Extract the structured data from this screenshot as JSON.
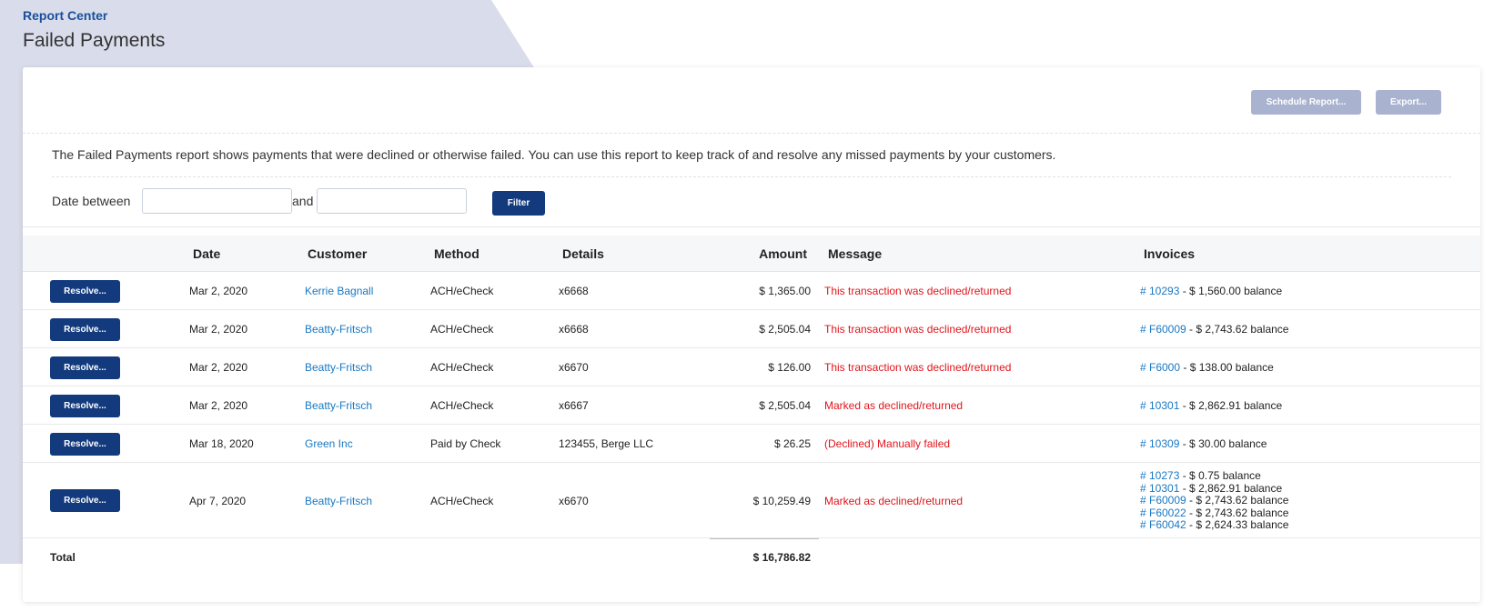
{
  "header": {
    "breadcrumb": "Report Center",
    "title": "Failed Payments"
  },
  "toolbar": {
    "schedule_label": "Schedule Report...",
    "export_label": "Export..."
  },
  "description": "The Failed Payments report shows payments that were declined or otherwise failed. You can use this report to keep track of and resolve any missed payments by your customers.",
  "filter": {
    "label": "Date between",
    "and": "and",
    "from_value": "",
    "to_value": "",
    "button": "Filter"
  },
  "columns": {
    "date": "Date",
    "customer": "Customer",
    "method": "Method",
    "details": "Details",
    "amount": "Amount",
    "message": "Message",
    "invoices": "Invoices"
  },
  "resolve_label": "Resolve...",
  "rows": [
    {
      "date": "Mar 2, 2020",
      "customer": "Kerrie Bagnall",
      "method": "ACH/eCheck",
      "details": "x6668",
      "amount": "$ 1,365.00",
      "message": "This transaction was declined/returned",
      "invoices": [
        {
          "num": "# 10293",
          "bal": " - $ 1,560.00 balance"
        }
      ]
    },
    {
      "date": "Mar 2, 2020",
      "customer": "Beatty-Fritsch",
      "method": "ACH/eCheck",
      "details": "x6668",
      "amount": "$ 2,505.04",
      "message": "This transaction was declined/returned",
      "invoices": [
        {
          "num": "# F60009",
          "bal": " - $ 2,743.62 balance"
        }
      ]
    },
    {
      "date": "Mar 2, 2020",
      "customer": "Beatty-Fritsch",
      "method": "ACH/eCheck",
      "details": "x6670",
      "amount": "$ 126.00",
      "message": "This transaction was declined/returned",
      "invoices": [
        {
          "num": "# F6000",
          "bal": " - $ 138.00 balance"
        }
      ]
    },
    {
      "date": "Mar 2, 2020",
      "customer": "Beatty-Fritsch",
      "method": "ACH/eCheck",
      "details": "x6667",
      "amount": "$ 2,505.04",
      "message": "Marked as declined/returned",
      "invoices": [
        {
          "num": "# 10301",
          "bal": " - $ 2,862.91 balance"
        }
      ]
    },
    {
      "date": "Mar 18, 2020",
      "customer": "Green Inc",
      "method": "Paid by Check",
      "details": "123455, Berge LLC",
      "amount": "$ 26.25",
      "message": "(Declined) Manually failed",
      "invoices": [
        {
          "num": "# 10309",
          "bal": " - $ 30.00 balance"
        }
      ]
    },
    {
      "date": "Apr 7, 2020",
      "customer": "Beatty-Fritsch",
      "method": "ACH/eCheck",
      "details": "x6670",
      "amount": "$ 10,259.49",
      "message": "Marked as declined/returned",
      "invoices": [
        {
          "num": "# 10273",
          "bal": " - $ 0.75 balance"
        },
        {
          "num": "# 10301",
          "bal": " - $ 2,862.91 balance"
        },
        {
          "num": "# F60009",
          "bal": " - $ 2,743.62 balance"
        },
        {
          "num": "# F60022",
          "bal": " - $ 2,743.62 balance"
        },
        {
          "num": "# F60042",
          "bal": " - $ 2,624.33 balance"
        }
      ]
    }
  ],
  "total": {
    "label": "Total",
    "amount": "$ 16,786.82"
  }
}
